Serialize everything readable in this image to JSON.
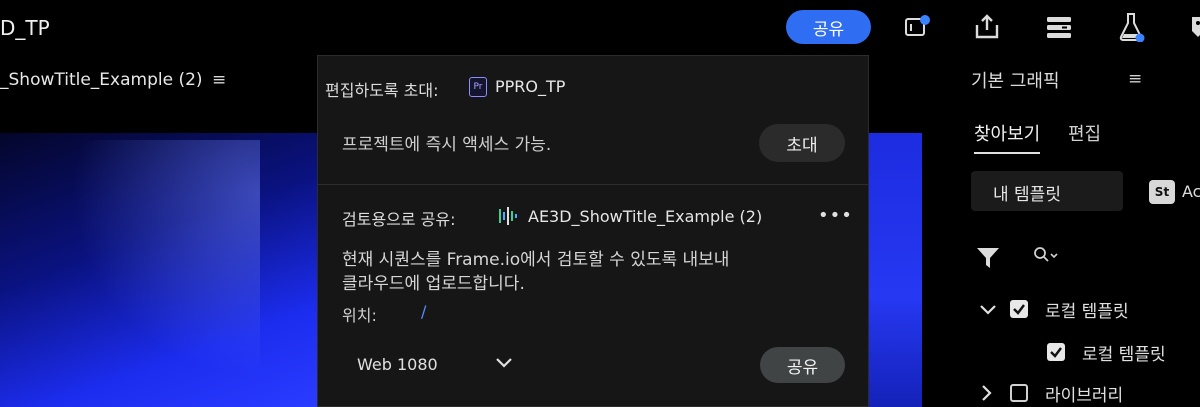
{
  "app": {
    "title": "D_TP"
  },
  "topbar": {
    "share_label": "공유",
    "icons": [
      "notification-icon",
      "export-icon",
      "panels-icon",
      "labs-icon",
      "tag-icon"
    ]
  },
  "sequence_panel": {
    "title": "_ShowTitle_Example (2)",
    "menu": "≡"
  },
  "share_popup": {
    "invite_label": "편집하도록 초대:",
    "project_badge": "Pr",
    "project_name": "PPRO_TP",
    "access_text": "프로젝트에 즉시 액세스 가능.",
    "invite_button": "초대",
    "review_label": "검토용으로 공유:",
    "sequence_name": "AE3D_ShowTitle_Example (2)",
    "more": "•••",
    "description_line1": "현재 시퀀스를 Frame.io에서 검토할 수 있도록 내보내",
    "description_line2": "클라우드에 업로드합니다.",
    "location_label": "위치:",
    "location_value": "/",
    "preset": "Web 1080",
    "share_button": "공유"
  },
  "graphics_panel": {
    "title": "기본 그래픽",
    "menu": "≡",
    "tabs": [
      "찾아보기",
      "편집"
    ],
    "template_source": "내 템플릿",
    "stock_badge": "St",
    "stock_text": "Ac",
    "tree": [
      {
        "label": "로컬 템플릿",
        "checked": true,
        "expanded": true
      },
      {
        "label": "로컬 템플릿",
        "checked": true,
        "child": true
      },
      {
        "label": "라이브러리",
        "checked": false,
        "expanded": false
      }
    ]
  },
  "colors": {
    "accent": "#2f6ef2",
    "notification": "#3b82ff",
    "location_link": "#5a8cff"
  }
}
